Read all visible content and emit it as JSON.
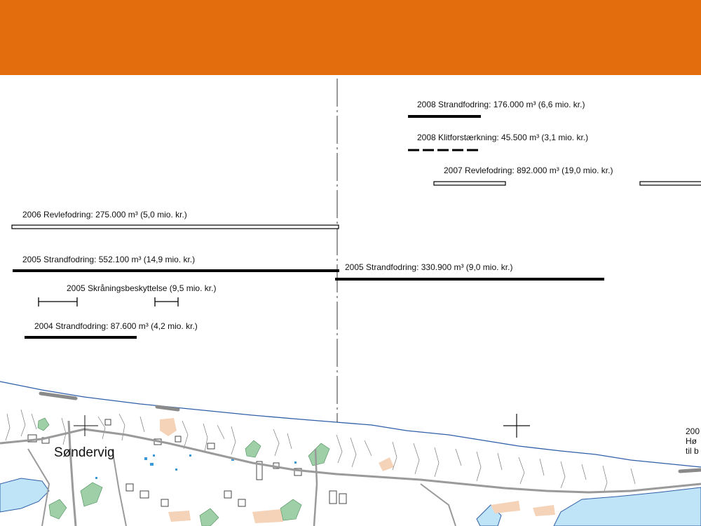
{
  "header": {
    "color": "#e36c0c"
  },
  "map": {
    "place_name": "Søndervig",
    "partial_text": [
      "200",
      "Hø",
      "til b"
    ]
  },
  "legend_items": [
    {
      "key": "s2008",
      "text": "2008 Strandfodring: 176.000 m³ (6,6 mio. kr.)",
      "style": "thick-solid"
    },
    {
      "key": "k2008",
      "text": "2008 Klitforstærkning: 45.500 m³ (3,1 mio. kr.)",
      "style": "dashed"
    },
    {
      "key": "r2007",
      "text": "2007 Revlefodring: 892.000 m³ (19,0 mio. kr.)",
      "style": "double"
    },
    {
      "key": "r2006",
      "text": "2006 Revlefodring: 275.000 m³ (5,0 mio. kr.)",
      "style": "double"
    },
    {
      "key": "s2005a",
      "text": "2005 Strandfodring: 552.100 m³ (14,9 mio. kr.)",
      "style": "thick-solid"
    },
    {
      "key": "s2005b",
      "text": "2005 Strandfodring: 330.900 m³ (9,0 mio. kr.)",
      "style": "thick-solid"
    },
    {
      "key": "sk2005",
      "text": "2005 Skråningsbeskyttelse (9,5 mio. kr.)",
      "style": "bracket"
    },
    {
      "key": "s2004",
      "text": "2004 Strandfodring: 87.600 m³ (4,2 mio. kr.)",
      "style": "thick-solid"
    }
  ],
  "colors": {
    "coastline": "#2f5fa8",
    "road": "#9a9a9a",
    "water": "#bfe4f7",
    "vegetation": "#9fcfa7",
    "urban": "#f4d3b9"
  }
}
